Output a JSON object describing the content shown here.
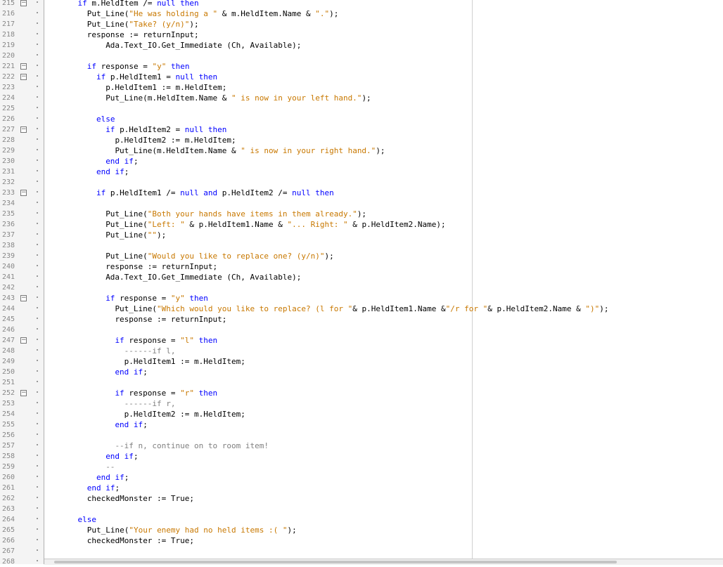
{
  "editor": {
    "lines": [
      {
        "n": "215",
        "fold": true,
        "indent": 4,
        "tokens": [
          [
            "kw",
            "if "
          ],
          [
            "",
            "m.HeldItem /= "
          ],
          [
            "kw",
            "null then"
          ]
        ]
      },
      {
        "n": "216",
        "fold": false,
        "indent": 6,
        "tokens": [
          [
            "",
            "Put_Line("
          ],
          [
            "str",
            "\"He was holding a \""
          ],
          [
            "",
            " & m.HeldItem.Name & "
          ],
          [
            "str",
            "\".\""
          ],
          [
            "",
            ");"
          ]
        ]
      },
      {
        "n": "217",
        "fold": false,
        "indent": 6,
        "tokens": [
          [
            "",
            "Put_Line("
          ],
          [
            "str",
            "\"Take? (y/n)\""
          ],
          [
            "",
            ");"
          ]
        ]
      },
      {
        "n": "218",
        "fold": false,
        "indent": 6,
        "tokens": [
          [
            "",
            "response := returnInput;"
          ]
        ]
      },
      {
        "n": "219",
        "fold": false,
        "indent": 10,
        "tokens": [
          [
            "",
            "Ada.Text_IO.Get_Immediate (Ch, Available);"
          ]
        ]
      },
      {
        "n": "220",
        "fold": false,
        "indent": 0,
        "tokens": []
      },
      {
        "n": "221",
        "fold": true,
        "indent": 6,
        "tokens": [
          [
            "kw",
            "if "
          ],
          [
            "",
            "response = "
          ],
          [
            "str",
            "\"y\""
          ],
          [
            "kw",
            " then"
          ]
        ]
      },
      {
        "n": "222",
        "fold": true,
        "indent": 8,
        "tokens": [
          [
            "kw",
            "if "
          ],
          [
            "",
            "p.HeldItem1 = "
          ],
          [
            "kw",
            "null then"
          ]
        ]
      },
      {
        "n": "223",
        "fold": false,
        "indent": 10,
        "tokens": [
          [
            "",
            "p.HeldItem1 := m.HeldItem;"
          ]
        ]
      },
      {
        "n": "224",
        "fold": false,
        "indent": 10,
        "tokens": [
          [
            "",
            "Put_Line(m.HeldItem.Name & "
          ],
          [
            "str",
            "\" is now in your left hand.\""
          ],
          [
            "",
            ");"
          ]
        ]
      },
      {
        "n": "225",
        "fold": false,
        "indent": 0,
        "tokens": []
      },
      {
        "n": "226",
        "fold": false,
        "indent": 8,
        "tokens": [
          [
            "kw",
            "else"
          ]
        ]
      },
      {
        "n": "227",
        "fold": true,
        "indent": 10,
        "tokens": [
          [
            "kw",
            "if "
          ],
          [
            "",
            "p.HeldItem2 = "
          ],
          [
            "kw",
            "null then"
          ]
        ]
      },
      {
        "n": "228",
        "fold": false,
        "indent": 12,
        "tokens": [
          [
            "",
            "p.HeldItem2 := m.HeldItem;"
          ]
        ]
      },
      {
        "n": "229",
        "fold": false,
        "indent": 12,
        "tokens": [
          [
            "",
            "Put_Line(m.HeldItem.Name & "
          ],
          [
            "str",
            "\" is now in your right hand.\""
          ],
          [
            "",
            ");"
          ]
        ]
      },
      {
        "n": "230",
        "fold": false,
        "indent": 10,
        "tokens": [
          [
            "kw",
            "end if"
          ],
          [
            "",
            ";"
          ]
        ]
      },
      {
        "n": "231",
        "fold": false,
        "indent": 8,
        "tokens": [
          [
            "kw",
            "end if"
          ],
          [
            "",
            ";"
          ]
        ]
      },
      {
        "n": "232",
        "fold": false,
        "indent": 0,
        "tokens": []
      },
      {
        "n": "233",
        "fold": true,
        "indent": 8,
        "tokens": [
          [
            "kw",
            "if "
          ],
          [
            "",
            "p.HeldItem1 /= "
          ],
          [
            "kw",
            "null and "
          ],
          [
            "",
            "p.HeldItem2 /= "
          ],
          [
            "kw",
            "null then"
          ]
        ]
      },
      {
        "n": "234",
        "fold": false,
        "indent": 0,
        "tokens": []
      },
      {
        "n": "235",
        "fold": false,
        "indent": 10,
        "tokens": [
          [
            "",
            "Put_Line("
          ],
          [
            "str",
            "\"Both your hands have items in them already.\""
          ],
          [
            "",
            ");"
          ]
        ]
      },
      {
        "n": "236",
        "fold": false,
        "indent": 10,
        "tokens": [
          [
            "",
            "Put_Line("
          ],
          [
            "str",
            "\"Left: \""
          ],
          [
            "",
            " & p.HeldItem1.Name & "
          ],
          [
            "str",
            "\"... Right: \""
          ],
          [
            "",
            " & p.HeldItem2.Name);"
          ]
        ]
      },
      {
        "n": "237",
        "fold": false,
        "indent": 10,
        "tokens": [
          [
            "",
            "Put_Line("
          ],
          [
            "str",
            "\"\""
          ],
          [
            "",
            ");"
          ]
        ]
      },
      {
        "n": "238",
        "fold": false,
        "indent": 0,
        "tokens": []
      },
      {
        "n": "239",
        "fold": false,
        "indent": 10,
        "tokens": [
          [
            "",
            "Put_Line("
          ],
          [
            "str",
            "\"Would you like to replace one? (y/n)\""
          ],
          [
            "",
            ");"
          ]
        ]
      },
      {
        "n": "240",
        "fold": false,
        "indent": 10,
        "tokens": [
          [
            "",
            "response := returnInput;"
          ]
        ]
      },
      {
        "n": "241",
        "fold": false,
        "indent": 10,
        "tokens": [
          [
            "",
            "Ada.Text_IO.Get_Immediate (Ch, Available);"
          ]
        ]
      },
      {
        "n": "242",
        "fold": false,
        "indent": 0,
        "tokens": []
      },
      {
        "n": "243",
        "fold": true,
        "indent": 10,
        "tokens": [
          [
            "kw",
            "if "
          ],
          [
            "",
            "response = "
          ],
          [
            "str",
            "\"y\""
          ],
          [
            "kw",
            " then"
          ]
        ]
      },
      {
        "n": "244",
        "fold": false,
        "indent": 12,
        "tokens": [
          [
            "",
            "Put_Line("
          ],
          [
            "str",
            "\"Which would you like to replace? (l for \""
          ],
          [
            "",
            "& p.HeldItem1.Name &"
          ],
          [
            "str",
            "\"/r for \""
          ],
          [
            "",
            "& p.HeldItem2.Name & "
          ],
          [
            "str",
            "\")\""
          ],
          [
            "",
            ");"
          ]
        ]
      },
      {
        "n": "245",
        "fold": false,
        "indent": 12,
        "tokens": [
          [
            "",
            "response := returnInput;"
          ]
        ]
      },
      {
        "n": "246",
        "fold": false,
        "indent": 0,
        "tokens": []
      },
      {
        "n": "247",
        "fold": true,
        "indent": 12,
        "tokens": [
          [
            "kw",
            "if "
          ],
          [
            "",
            "response = "
          ],
          [
            "str",
            "\"l\""
          ],
          [
            "kw",
            " then"
          ]
        ]
      },
      {
        "n": "248",
        "fold": false,
        "indent": 14,
        "tokens": [
          [
            "cmt",
            "------if l,"
          ]
        ]
      },
      {
        "n": "249",
        "fold": false,
        "indent": 14,
        "tokens": [
          [
            "",
            "p.HeldItem1 := m.HeldItem;"
          ]
        ]
      },
      {
        "n": "250",
        "fold": false,
        "indent": 12,
        "tokens": [
          [
            "kw",
            "end if"
          ],
          [
            "",
            ";"
          ]
        ]
      },
      {
        "n": "251",
        "fold": false,
        "indent": 0,
        "tokens": []
      },
      {
        "n": "252",
        "fold": true,
        "indent": 12,
        "tokens": [
          [
            "kw",
            "if "
          ],
          [
            "",
            "response = "
          ],
          [
            "str",
            "\"r\""
          ],
          [
            "kw",
            " then"
          ]
        ]
      },
      {
        "n": "253",
        "fold": false,
        "indent": 14,
        "tokens": [
          [
            "cmt",
            "------if r,"
          ]
        ]
      },
      {
        "n": "254",
        "fold": false,
        "indent": 14,
        "tokens": [
          [
            "",
            "p.HeldItem2 := m.HeldItem;"
          ]
        ]
      },
      {
        "n": "255",
        "fold": false,
        "indent": 12,
        "tokens": [
          [
            "kw",
            "end if"
          ],
          [
            "",
            ";"
          ]
        ]
      },
      {
        "n": "256",
        "fold": false,
        "indent": 0,
        "tokens": []
      },
      {
        "n": "257",
        "fold": false,
        "indent": 12,
        "tokens": [
          [
            "cmt",
            "--if n, continue on to room item!"
          ]
        ]
      },
      {
        "n": "258",
        "fold": false,
        "indent": 10,
        "tokens": [
          [
            "kw",
            "end if"
          ],
          [
            "",
            ";"
          ]
        ]
      },
      {
        "n": "259",
        "fold": false,
        "indent": 10,
        "tokens": [
          [
            "cmt",
            "--"
          ]
        ]
      },
      {
        "n": "260",
        "fold": false,
        "indent": 8,
        "tokens": [
          [
            "kw",
            "end if"
          ],
          [
            "",
            ";"
          ]
        ]
      },
      {
        "n": "261",
        "fold": false,
        "indent": 6,
        "tokens": [
          [
            "kw",
            "end if"
          ],
          [
            "",
            ";"
          ]
        ]
      },
      {
        "n": "262",
        "fold": false,
        "indent": 6,
        "tokens": [
          [
            "",
            "checkedMonster := True;"
          ]
        ]
      },
      {
        "n": "263",
        "fold": false,
        "indent": 0,
        "tokens": []
      },
      {
        "n": "264",
        "fold": false,
        "indent": 4,
        "tokens": [
          [
            "kw",
            "else"
          ]
        ]
      },
      {
        "n": "265",
        "fold": false,
        "indent": 6,
        "tokens": [
          [
            "",
            "Put_Line("
          ],
          [
            "str",
            "\"Your enemy had no held items :( \""
          ],
          [
            "",
            ");"
          ]
        ]
      },
      {
        "n": "266",
        "fold": false,
        "indent": 6,
        "tokens": [
          [
            "",
            "checkedMonster := True;"
          ]
        ]
      },
      {
        "n": "267",
        "fold": false,
        "indent": 0,
        "tokens": []
      },
      {
        "n": "268",
        "fold": false,
        "indent": 4,
        "tokens": [
          [
            "kw",
            "end if"
          ],
          [
            "",
            ";"
          ]
        ]
      }
    ]
  }
}
